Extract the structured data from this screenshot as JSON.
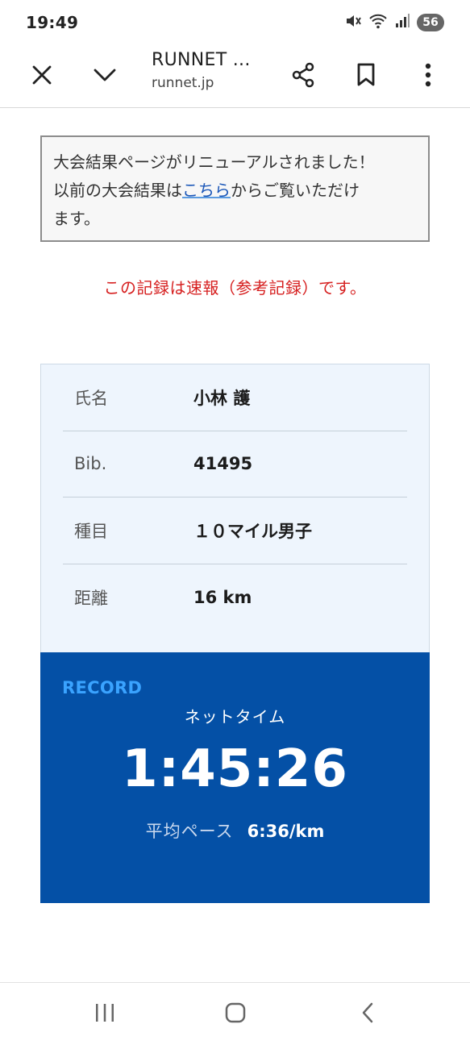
{
  "status_bar": {
    "time": "19:49",
    "battery": "56",
    "icons": [
      "mute-icon",
      "wifi-icon",
      "signal-icon"
    ]
  },
  "toolbar": {
    "title": "RUNNET ...",
    "url": "runnet.jp",
    "icons": [
      "close-icon",
      "chevron-down-icon",
      "share-icon",
      "bookmark-icon",
      "more-vert-icon"
    ]
  },
  "content": {
    "notice": {
      "line1": "大会結果ページがリニューアルされました！",
      "line2_before": "以前の大会結果は",
      "link_text": "こちら",
      "line2_after": "からご覧いただけ",
      "line3": "ます。"
    },
    "warning": "この記録は速報（参考記録）です。",
    "info": [
      {
        "label": "氏名",
        "value": "小林 護"
      },
      {
        "label": "Bib.",
        "value": "41495"
      },
      {
        "label": "種目",
        "value": "１０マイル男子"
      },
      {
        "label": "距離",
        "value": "16 km"
      }
    ],
    "record": {
      "label": "RECORD",
      "net_time_label": "ネットタイム",
      "net_time": "1:45:26",
      "pace_label": "平均ペース",
      "pace_value": "6:36/km"
    }
  },
  "nav_bar": {
    "icons": [
      "recents-icon",
      "home-icon",
      "back-icon"
    ]
  },
  "colors": {
    "record_bg": "#0450a6",
    "record_label": "#3aa3ff",
    "warning": "#d61f1f",
    "info_bg": "#eef5fd",
    "link": "#1a56b8"
  }
}
